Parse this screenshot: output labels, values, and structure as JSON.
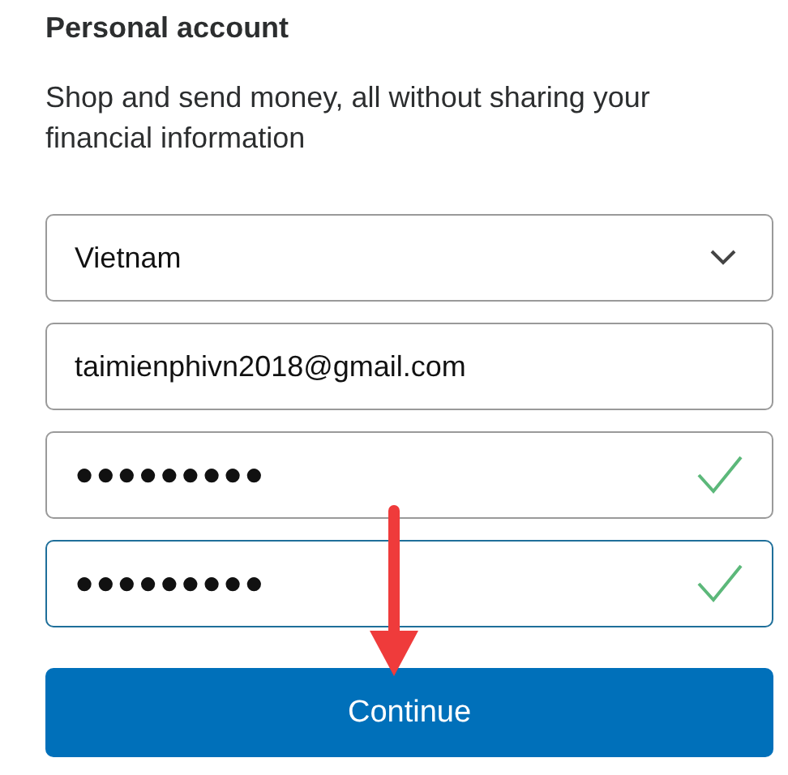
{
  "title": "Personal account",
  "description": "Shop and send money, all without sharing your financial information",
  "fields": [
    {
      "kind": "select",
      "value": "Vietnam",
      "valid": false,
      "focused": false
    },
    {
      "kind": "text",
      "value": "taimienphivn2018@gmail.com",
      "valid": false,
      "focused": false
    },
    {
      "kind": "password",
      "value": "●●●●●●●●●",
      "valid": true,
      "focused": false
    },
    {
      "kind": "password",
      "value": "●●●●●●●●●",
      "valid": true,
      "focused": true
    }
  ],
  "button": "Continue"
}
